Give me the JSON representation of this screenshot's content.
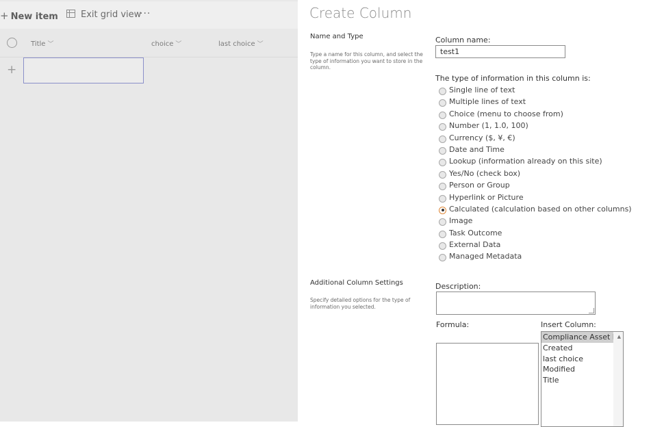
{
  "list": {
    "commands": {
      "new_item": "New item",
      "exit_grid": "Exit grid view",
      "more": "···"
    },
    "columns": [
      {
        "label": "Title"
      },
      {
        "label": "choice"
      },
      {
        "label": "last choice"
      }
    ],
    "add_row": "+"
  },
  "panel": {
    "title": "Create Column",
    "name_type": {
      "heading": "Name and Type",
      "description": "Type a name for this column, and select the type of information you want to store in the column.",
      "column_name_label": "Column name:",
      "column_name_value": "test1",
      "type_label": "The type of information in this column is:",
      "types": [
        {
          "label": "Single line of text",
          "selected": false
        },
        {
          "label": "Multiple lines of text",
          "selected": false
        },
        {
          "label": "Choice (menu to choose from)",
          "selected": false
        },
        {
          "label": "Number (1, 1.0, 100)",
          "selected": false
        },
        {
          "label": "Currency ($, ¥, €)",
          "selected": false
        },
        {
          "label": "Date and Time",
          "selected": false
        },
        {
          "label": "Lookup (information already on this site)",
          "selected": false
        },
        {
          "label": "Yes/No (check box)",
          "selected": false
        },
        {
          "label": "Person or Group",
          "selected": false
        },
        {
          "label": "Hyperlink or Picture",
          "selected": false
        },
        {
          "label": "Calculated (calculation based on other columns)",
          "selected": true
        },
        {
          "label": "Image",
          "selected": false
        },
        {
          "label": "Task Outcome",
          "selected": false
        },
        {
          "label": "External Data",
          "selected": false
        },
        {
          "label": "Managed Metadata",
          "selected": false
        }
      ]
    },
    "additional": {
      "heading": "Additional Column Settings",
      "description": "Specify detailed options for the type of information you selected.",
      "description_label": "Description:",
      "formula_label": "Formula:",
      "insert_column_label": "Insert Column:",
      "insert_columns": [
        "Compliance Asset Id",
        "Created",
        "last choice",
        "Modified",
        "Title"
      ]
    }
  },
  "colors": {
    "selected_radio_border": "#e08a3a",
    "title_cell_border": "#8a8fc9"
  }
}
